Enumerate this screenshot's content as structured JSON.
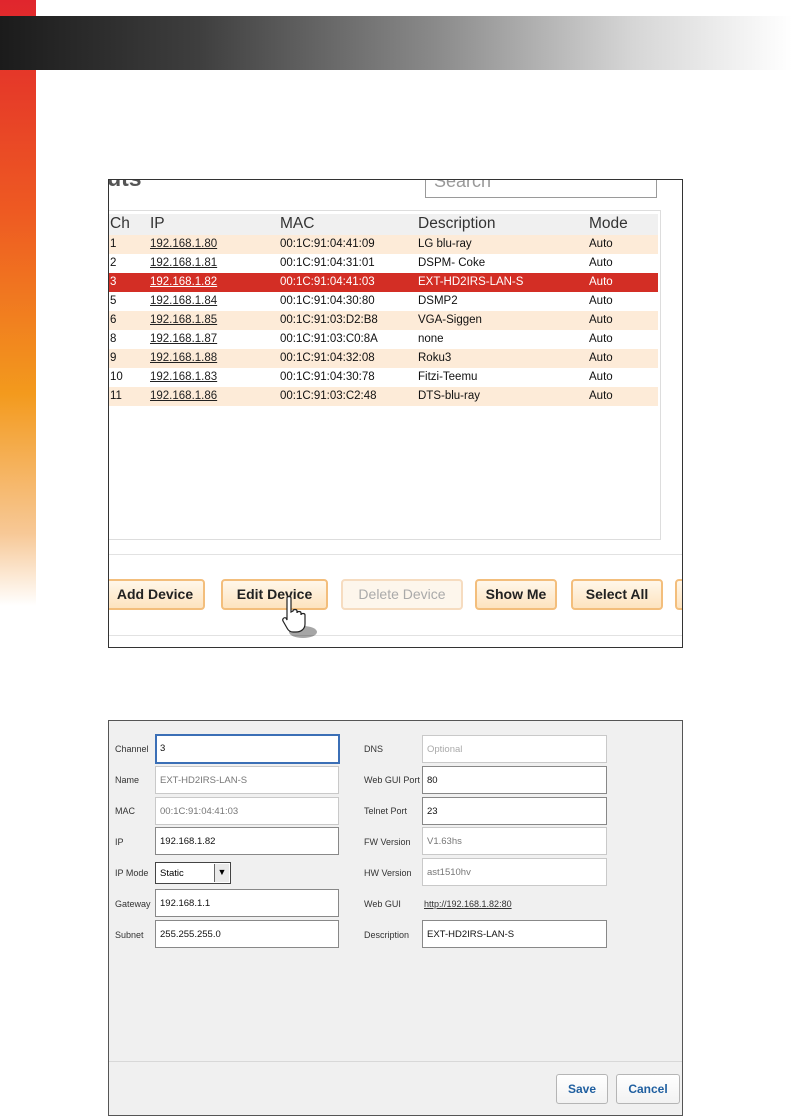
{
  "header": {
    "section_title": ""
  },
  "panel1": {
    "heading": "nputs",
    "search_placeholder": "Search",
    "columns": {
      "ch": "Ch",
      "ip": "IP",
      "mac": "MAC",
      "description": "Description",
      "mode": "Mode"
    },
    "rows": [
      {
        "ch": "1",
        "ip": "192.168.1.80",
        "mac": "00:1C:91:04:41:09",
        "description": "LG blu-ray",
        "mode": "Auto"
      },
      {
        "ch": "2",
        "ip": "192.168.1.81",
        "mac": "00:1C:91:04:31:01",
        "description": "DSPM- Coke",
        "mode": "Auto"
      },
      {
        "ch": "3",
        "ip": "192.168.1.82",
        "mac": "00:1C:91:04:41:03",
        "description": "EXT-HD2IRS-LAN-S",
        "mode": "Auto"
      },
      {
        "ch": "5",
        "ip": "192.168.1.84",
        "mac": "00:1C:91:04:30:80",
        "description": "DSMP2",
        "mode": "Auto"
      },
      {
        "ch": "6",
        "ip": "192.168.1.85",
        "mac": "00:1C:91:03:D2:B8",
        "description": "VGA-Siggen",
        "mode": "Auto"
      },
      {
        "ch": "8",
        "ip": "192.168.1.87",
        "mac": "00:1C:91:03:C0:8A",
        "description": "none",
        "mode": "Auto"
      },
      {
        "ch": "9",
        "ip": "192.168.1.88",
        "mac": "00:1C:91:04:32:08",
        "description": "Roku3",
        "mode": "Auto"
      },
      {
        "ch": "10",
        "ip": "192.168.1.83",
        "mac": "00:1C:91:04:30:78",
        "description": "Fitzi-Teemu",
        "mode": "Auto"
      },
      {
        "ch": "11",
        "ip": "192.168.1.86",
        "mac": "00:1C:91:03:C2:48",
        "description": "DTS-blu-ray",
        "mode": "Auto"
      }
    ],
    "selected_row": 2,
    "buttons": {
      "add": "Add Device",
      "edit": "Edit Device",
      "delete": "Delete Device",
      "show": "Show Me",
      "select_all": "Select All"
    },
    "cursor_icon": "hand-pointer-icon"
  },
  "panel2": {
    "labels": {
      "channel": "Channel",
      "name": "Name",
      "mac": "MAC",
      "ip": "IP",
      "ip_mode": "IP Mode",
      "gateway": "Gateway",
      "subnet": "Subnet",
      "dns": "DNS",
      "web_gui_port": "Web GUI Port",
      "telnet_port": "Telnet Port",
      "fw_version": "FW Version",
      "hw_version": "HW Version",
      "web_gui": "Web GUI",
      "description": "Description"
    },
    "values": {
      "channel": "3",
      "name": "EXT-HD2IRS-LAN-S",
      "mac": "00:1C:91:04:41:03",
      "ip": "192.168.1.82",
      "ip_mode": "Static",
      "gateway": "192.168.1.1",
      "subnet": "255.255.255.0",
      "dns_placeholder": "Optional",
      "web_gui_port": "80",
      "telnet_port": "23",
      "fw_version": "V1.63hs",
      "hw_version": "ast1510hv",
      "web_gui_link": "http://192.168.1.82:80",
      "description": "EXT-HD2IRS-LAN-S"
    },
    "buttons": {
      "save": "Save",
      "cancel": "Cancel"
    }
  },
  "colors": {
    "selected_row": "#d32e25",
    "row_alt": "#fdebd8",
    "button_border": "#f3be7c",
    "focus_border": "#3b6fb6",
    "save_text": "#1f5fa0"
  }
}
